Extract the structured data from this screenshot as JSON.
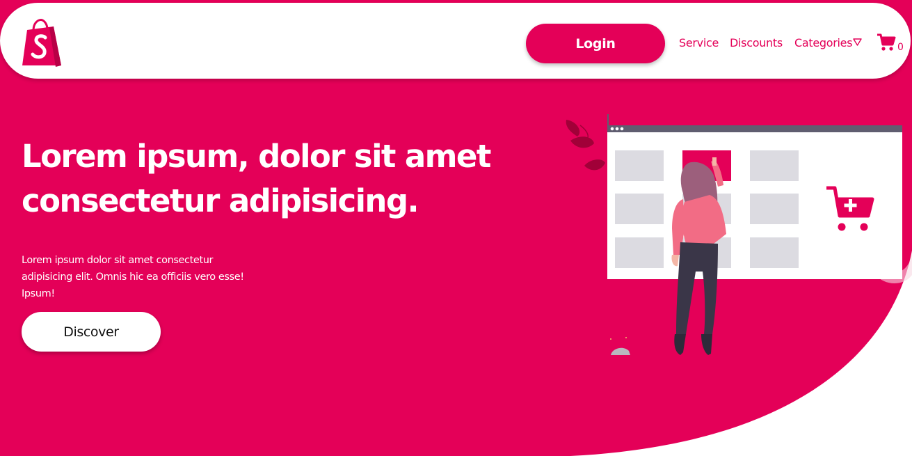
{
  "colors": {
    "brand": "#e40058",
    "background": "#ffffff"
  },
  "header": {
    "logo_icon": "shopping-bag-logo-icon",
    "login_label": "Login",
    "nav": {
      "service": "Service",
      "discounts": "Discounts",
      "categories": "Categories"
    },
    "categories_icon": "triangle-down-icon",
    "cart_icon": "shopping-cart-icon",
    "cart_count": "0"
  },
  "hero": {
    "title_line1": "Lorem ipsum, dolor sit amet",
    "title_line2": "consectetur adipisicing.",
    "text": "Lorem ipsum dolor sit amet consectetur adipisicing elit. Omnis hic ea officiis vero esse! Ipsum!",
    "discover_label": "Discover",
    "illustration_icon": "online-shopping-illustration"
  }
}
